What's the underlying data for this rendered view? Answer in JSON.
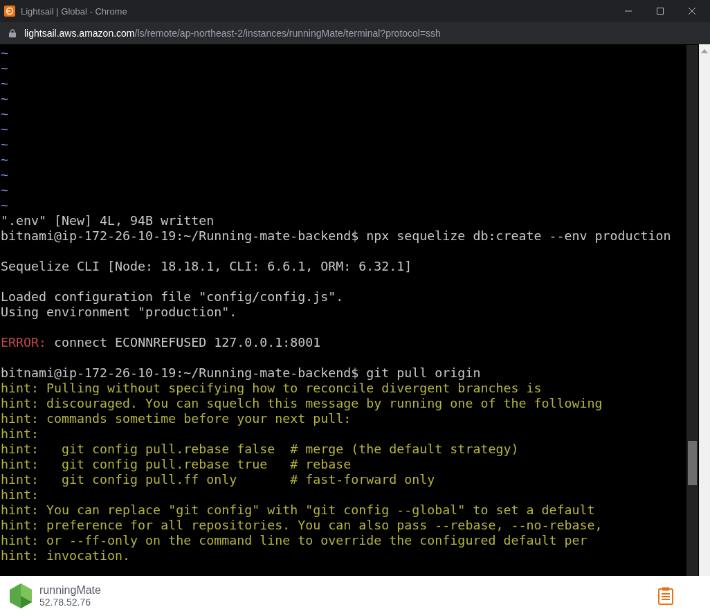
{
  "window": {
    "title": "Lightsail | Global - Chrome"
  },
  "address_bar": {
    "host": "lightsail.aws.amazon.com",
    "path": "/ls/remote/ap-northeast-2/instances/runningMate/terminal?protocol=ssh"
  },
  "terminal": {
    "lines": [
      {
        "kind": "tilde",
        "text": "~"
      },
      {
        "kind": "tilde",
        "text": "~"
      },
      {
        "kind": "tilde",
        "text": "~"
      },
      {
        "kind": "tilde",
        "text": "~"
      },
      {
        "kind": "tilde",
        "text": "~"
      },
      {
        "kind": "tilde",
        "text": "~"
      },
      {
        "kind": "tilde",
        "text": "~"
      },
      {
        "kind": "tilde",
        "text": "~"
      },
      {
        "kind": "tilde",
        "text": "~"
      },
      {
        "kind": "tilde",
        "text": "~"
      },
      {
        "kind": "tilde",
        "text": "~"
      },
      {
        "kind": "text",
        "text": "\".env\" [New] 4L, 94B written"
      },
      {
        "kind": "text",
        "text": "bitnami@ip-172-26-10-19:~/Running-mate-backend$ npx sequelize db:create --env production"
      },
      {
        "kind": "blank"
      },
      {
        "kind": "text",
        "text": "Sequelize CLI [Node: 18.18.1, CLI: 6.6.1, ORM: 6.32.1]"
      },
      {
        "kind": "blank"
      },
      {
        "kind": "text",
        "text": "Loaded configuration file \"config/config.js\"."
      },
      {
        "kind": "text",
        "text": "Using environment \"production\"."
      },
      {
        "kind": "blank"
      },
      {
        "kind": "error",
        "label": "ERROR:",
        "text": "connect ECONNREFUSED 127.0.0.1:8001"
      },
      {
        "kind": "blank"
      },
      {
        "kind": "text",
        "text": "bitnami@ip-172-26-10-19:~/Running-mate-backend$ git pull origin"
      },
      {
        "kind": "hint",
        "text": "hint: Pulling without specifying how to reconcile divergent branches is"
      },
      {
        "kind": "hint",
        "text": "hint: discouraged. You can squelch this message by running one of the following"
      },
      {
        "kind": "hint",
        "text": "hint: commands sometime before your next pull:"
      },
      {
        "kind": "hint",
        "text": "hint:"
      },
      {
        "kind": "hint",
        "text": "hint:   git config pull.rebase false  # merge (the default strategy)"
      },
      {
        "kind": "hint",
        "text": "hint:   git config pull.rebase true   # rebase"
      },
      {
        "kind": "hint",
        "text": "hint:   git config pull.ff only       # fast-forward only"
      },
      {
        "kind": "hint",
        "text": "hint:"
      },
      {
        "kind": "hint",
        "text": "hint: You can replace \"git config\" with \"git config --global\" to set a default"
      },
      {
        "kind": "hint",
        "text": "hint: preference for all repositories. You can also pass --rebase, --no-rebase,"
      },
      {
        "kind": "hint",
        "text": "hint: or --ff-only on the command line to override the configured default per"
      },
      {
        "kind": "hint",
        "text": "hint: invocation."
      }
    ]
  },
  "instance": {
    "name": "runningMate",
    "ip": "52.78.52.76"
  }
}
